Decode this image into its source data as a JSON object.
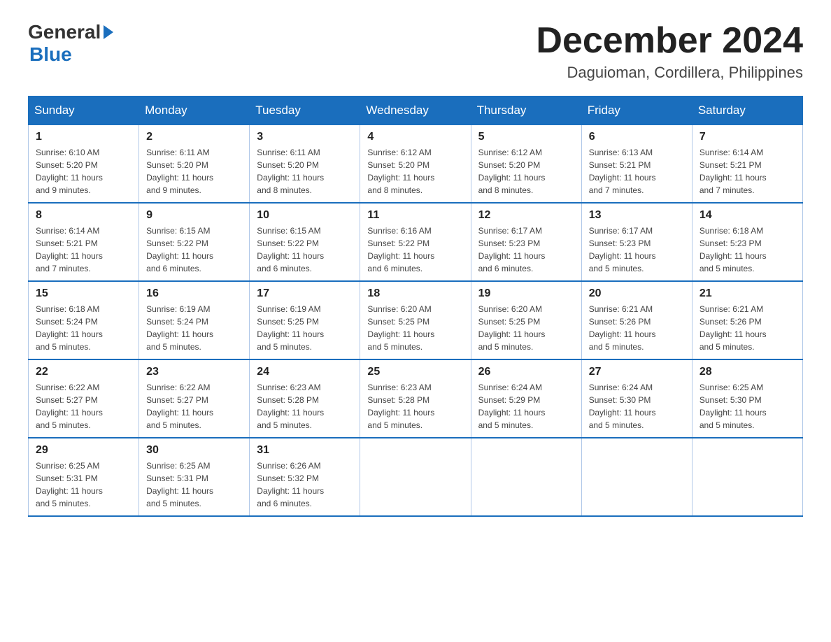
{
  "header": {
    "logo_general": "General",
    "logo_blue": "Blue",
    "month_year": "December 2024",
    "location": "Daguioman, Cordillera, Philippines"
  },
  "days_of_week": [
    "Sunday",
    "Monday",
    "Tuesday",
    "Wednesday",
    "Thursday",
    "Friday",
    "Saturday"
  ],
  "weeks": [
    [
      {
        "num": "1",
        "sunrise": "6:10 AM",
        "sunset": "5:20 PM",
        "daylight": "11 hours and 9 minutes."
      },
      {
        "num": "2",
        "sunrise": "6:11 AM",
        "sunset": "5:20 PM",
        "daylight": "11 hours and 9 minutes."
      },
      {
        "num": "3",
        "sunrise": "6:11 AM",
        "sunset": "5:20 PM",
        "daylight": "11 hours and 8 minutes."
      },
      {
        "num": "4",
        "sunrise": "6:12 AM",
        "sunset": "5:20 PM",
        "daylight": "11 hours and 8 minutes."
      },
      {
        "num": "5",
        "sunrise": "6:12 AM",
        "sunset": "5:20 PM",
        "daylight": "11 hours and 8 minutes."
      },
      {
        "num": "6",
        "sunrise": "6:13 AM",
        "sunset": "5:21 PM",
        "daylight": "11 hours and 7 minutes."
      },
      {
        "num": "7",
        "sunrise": "6:14 AM",
        "sunset": "5:21 PM",
        "daylight": "11 hours and 7 minutes."
      }
    ],
    [
      {
        "num": "8",
        "sunrise": "6:14 AM",
        "sunset": "5:21 PM",
        "daylight": "11 hours and 7 minutes."
      },
      {
        "num": "9",
        "sunrise": "6:15 AM",
        "sunset": "5:22 PM",
        "daylight": "11 hours and 6 minutes."
      },
      {
        "num": "10",
        "sunrise": "6:15 AM",
        "sunset": "5:22 PM",
        "daylight": "11 hours and 6 minutes."
      },
      {
        "num": "11",
        "sunrise": "6:16 AM",
        "sunset": "5:22 PM",
        "daylight": "11 hours and 6 minutes."
      },
      {
        "num": "12",
        "sunrise": "6:17 AM",
        "sunset": "5:23 PM",
        "daylight": "11 hours and 6 minutes."
      },
      {
        "num": "13",
        "sunrise": "6:17 AM",
        "sunset": "5:23 PM",
        "daylight": "11 hours and 5 minutes."
      },
      {
        "num": "14",
        "sunrise": "6:18 AM",
        "sunset": "5:23 PM",
        "daylight": "11 hours and 5 minutes."
      }
    ],
    [
      {
        "num": "15",
        "sunrise": "6:18 AM",
        "sunset": "5:24 PM",
        "daylight": "11 hours and 5 minutes."
      },
      {
        "num": "16",
        "sunrise": "6:19 AM",
        "sunset": "5:24 PM",
        "daylight": "11 hours and 5 minutes."
      },
      {
        "num": "17",
        "sunrise": "6:19 AM",
        "sunset": "5:25 PM",
        "daylight": "11 hours and 5 minutes."
      },
      {
        "num": "18",
        "sunrise": "6:20 AM",
        "sunset": "5:25 PM",
        "daylight": "11 hours and 5 minutes."
      },
      {
        "num": "19",
        "sunrise": "6:20 AM",
        "sunset": "5:25 PM",
        "daylight": "11 hours and 5 minutes."
      },
      {
        "num": "20",
        "sunrise": "6:21 AM",
        "sunset": "5:26 PM",
        "daylight": "11 hours and 5 minutes."
      },
      {
        "num": "21",
        "sunrise": "6:21 AM",
        "sunset": "5:26 PM",
        "daylight": "11 hours and 5 minutes."
      }
    ],
    [
      {
        "num": "22",
        "sunrise": "6:22 AM",
        "sunset": "5:27 PM",
        "daylight": "11 hours and 5 minutes."
      },
      {
        "num": "23",
        "sunrise": "6:22 AM",
        "sunset": "5:27 PM",
        "daylight": "11 hours and 5 minutes."
      },
      {
        "num": "24",
        "sunrise": "6:23 AM",
        "sunset": "5:28 PM",
        "daylight": "11 hours and 5 minutes."
      },
      {
        "num": "25",
        "sunrise": "6:23 AM",
        "sunset": "5:28 PM",
        "daylight": "11 hours and 5 minutes."
      },
      {
        "num": "26",
        "sunrise": "6:24 AM",
        "sunset": "5:29 PM",
        "daylight": "11 hours and 5 minutes."
      },
      {
        "num": "27",
        "sunrise": "6:24 AM",
        "sunset": "5:30 PM",
        "daylight": "11 hours and 5 minutes."
      },
      {
        "num": "28",
        "sunrise": "6:25 AM",
        "sunset": "5:30 PM",
        "daylight": "11 hours and 5 minutes."
      }
    ],
    [
      {
        "num": "29",
        "sunrise": "6:25 AM",
        "sunset": "5:31 PM",
        "daylight": "11 hours and 5 minutes."
      },
      {
        "num": "30",
        "sunrise": "6:25 AM",
        "sunset": "5:31 PM",
        "daylight": "11 hours and 5 minutes."
      },
      {
        "num": "31",
        "sunrise": "6:26 AM",
        "sunset": "5:32 PM",
        "daylight": "11 hours and 6 minutes."
      },
      null,
      null,
      null,
      null
    ]
  ],
  "labels": {
    "sunrise": "Sunrise:",
    "sunset": "Sunset:",
    "daylight": "Daylight:"
  }
}
